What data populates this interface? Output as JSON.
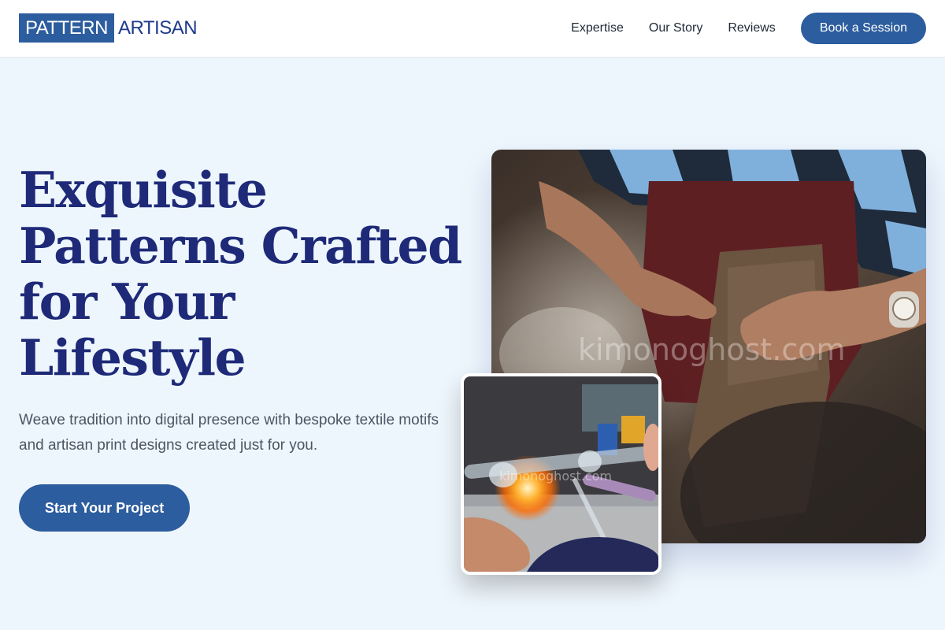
{
  "brand": {
    "box_text": "PATTERN",
    "text": "ARTISAN"
  },
  "nav": {
    "links": [
      "Expertise",
      "Our Story",
      "Reviews"
    ],
    "cta": "Book a Session"
  },
  "hero": {
    "title_lines": [
      "Exquisite",
      "Patterns Crafted",
      "for Your",
      "Lifestyle"
    ],
    "subtitle": "Weave tradition into digital presence with bespoke textile motifs and artisan print designs created just for you.",
    "cta": "Start Your Project"
  },
  "images": {
    "main_watermark": "kimonoghost.com",
    "small_watermark": "kimonoghost.com"
  },
  "colors": {
    "primary": "#2c5d9e",
    "heading": "#1e2a78",
    "background": "#eef6fd"
  }
}
